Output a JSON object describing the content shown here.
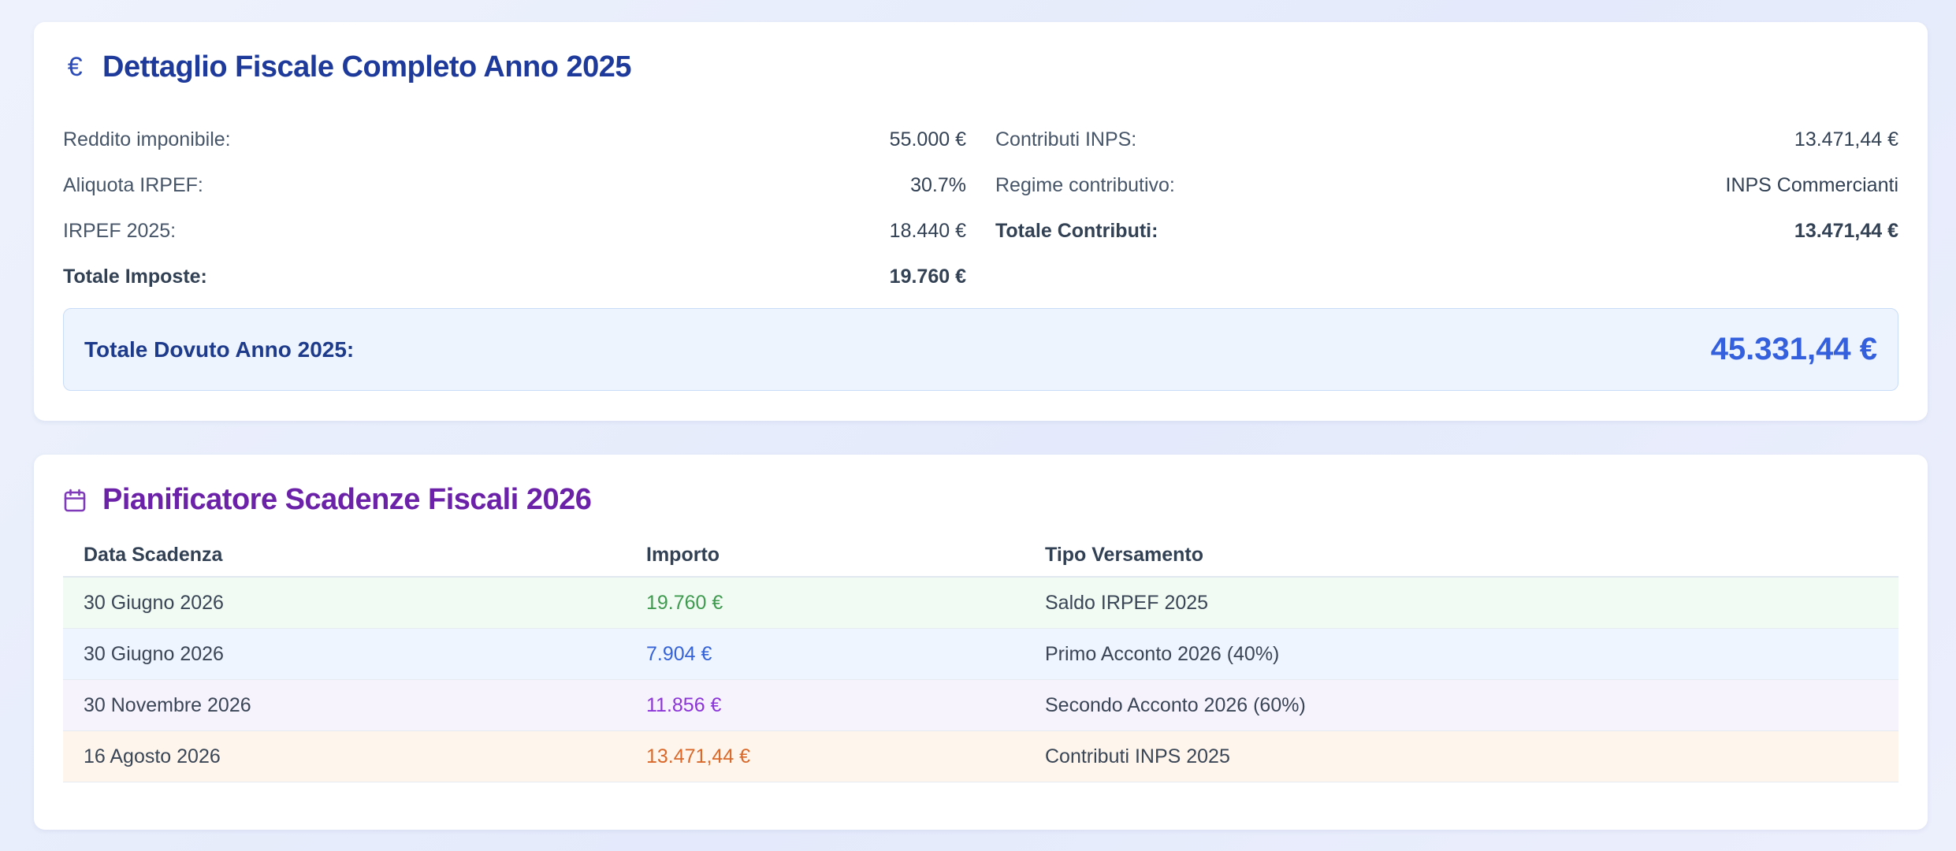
{
  "fiscal": {
    "title": "Dettaglio Fiscale Completo Anno 2025",
    "icon": "euro-icon",
    "left_rows": [
      {
        "label": "Reddito imponibile:",
        "value": "55.000 €"
      },
      {
        "label": "Aliquota IRPEF:",
        "value": "30.7%"
      },
      {
        "label": "IRPEF 2025:",
        "value": "18.440 €"
      },
      {
        "label": "Totale Imposte:",
        "value": "19.760 €"
      }
    ],
    "right_rows": [
      {
        "label": "Contributi INPS:",
        "value": "13.471,44 €"
      },
      {
        "label": "Regime contributivo:",
        "value": "INPS Commercianti"
      },
      {
        "label": "Totale Contributi:",
        "value": "13.471,44 €"
      }
    ],
    "total": {
      "label": "Totale Dovuto Anno 2025:",
      "value": "45.331,44 €"
    }
  },
  "planner": {
    "title": "Pianificatore Scadenze Fiscali 2026",
    "icon": "calendar-icon",
    "columns": [
      "Data Scadenza",
      "Importo",
      "Tipo Versamento"
    ],
    "rows": [
      {
        "date": "30 Giugno 2026",
        "amount": "19.760 €",
        "type": "Saldo IRPEF 2025",
        "bg": "#f1fbf3",
        "amount_color": "#3f9a4f"
      },
      {
        "date": "30 Giugno 2026",
        "amount": "7.904 €",
        "type": "Primo Acconto 2026 (40%)",
        "bg": "#eff5fe",
        "amount_color": "#3462d8"
      },
      {
        "date": "30 Novembre 2026",
        "amount": "11.856 €",
        "type": "Secondo Acconto 2026 (60%)",
        "bg": "#f7f3fd",
        "amount_color": "#8b35d8"
      },
      {
        "date": "16 Agosto 2026",
        "amount": "13.471,44 €",
        "type": "Contributi INPS 2025",
        "bg": "#fef6ec",
        "amount_color": "#d9682a"
      }
    ]
  }
}
